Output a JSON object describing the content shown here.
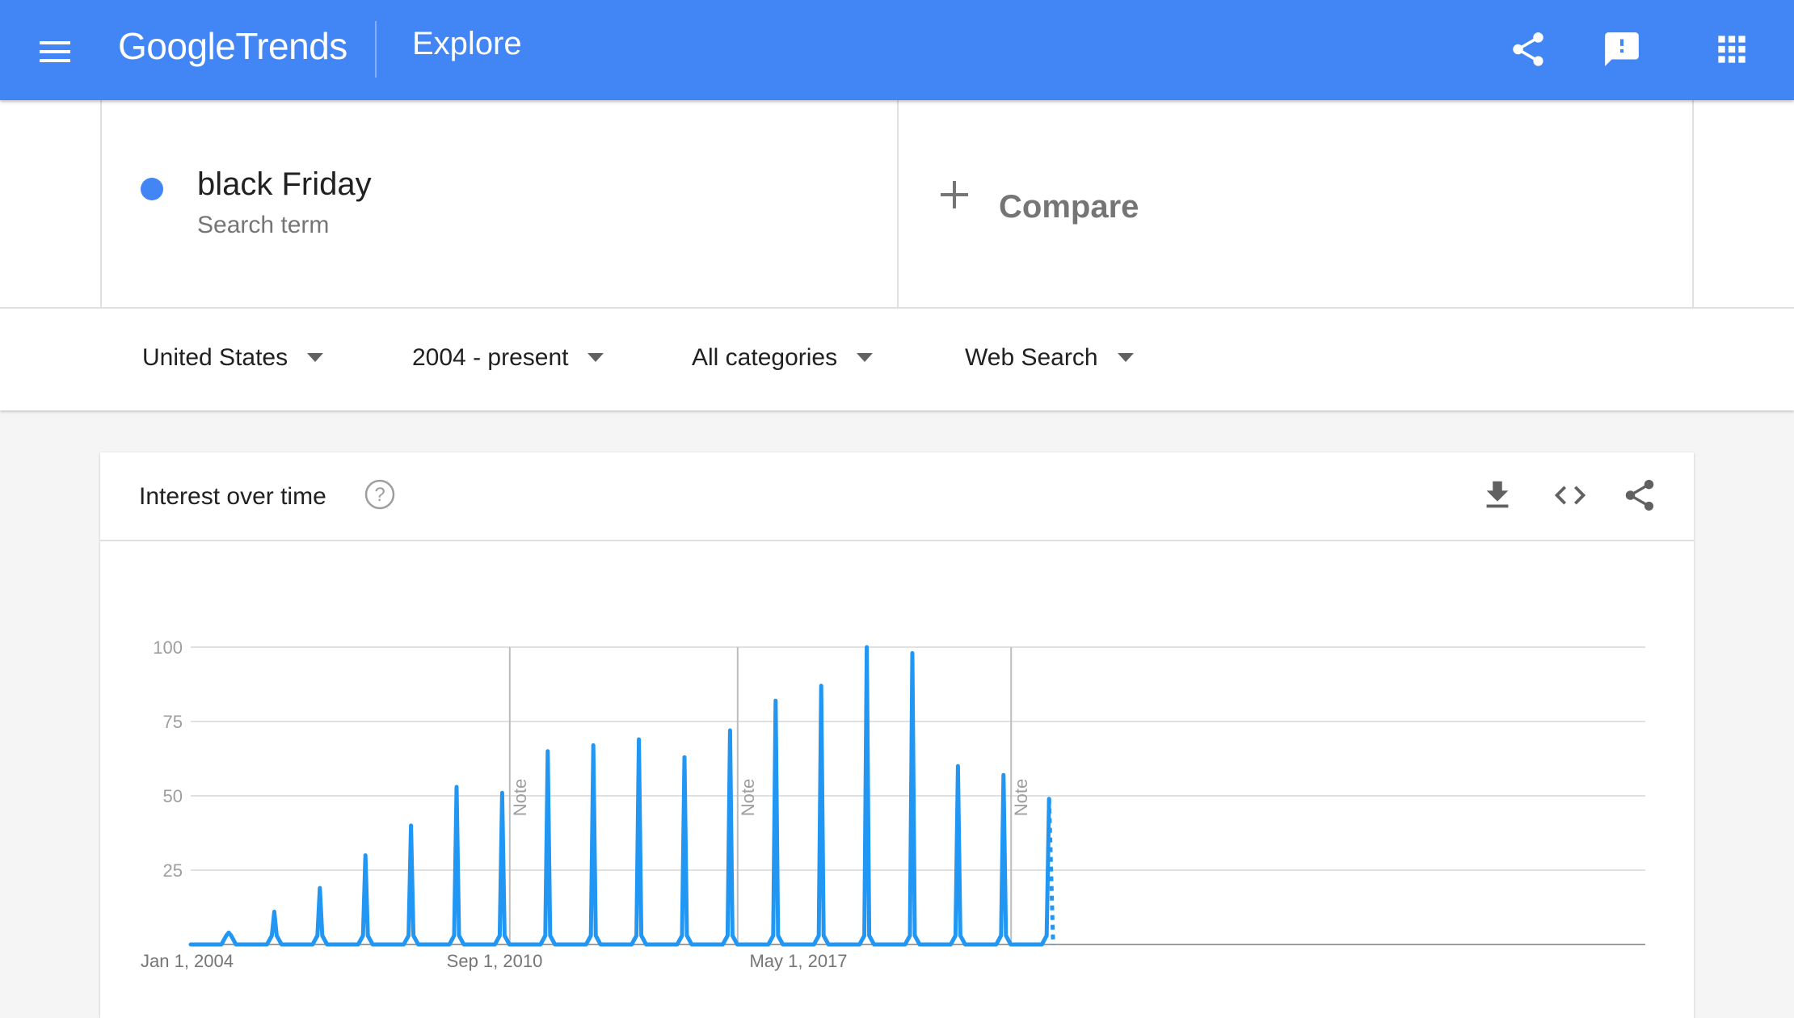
{
  "appbar": {
    "logo_google": "Google",
    "logo_trends": "Trends",
    "page": "Explore",
    "icons": [
      "menu-icon",
      "share-icon",
      "feedback-icon",
      "apps-icon"
    ]
  },
  "terms": {
    "term": {
      "name": "black Friday",
      "type": "Search term",
      "color": "#4285f4"
    },
    "compare_label": "Compare"
  },
  "filters": [
    {
      "label": "United States"
    },
    {
      "label": "2004 - present"
    },
    {
      "label": "All categories"
    },
    {
      "label": "Web Search"
    }
  ],
  "card": {
    "title": "Interest over time",
    "tools": [
      "download-icon",
      "embed-icon",
      "share-icon"
    ]
  },
  "colors": {
    "accent": "#4285f4",
    "series": "#2196f3",
    "grid": "#e0e0e0"
  },
  "chart_data": {
    "type": "line",
    "title": "",
    "xlabel": "",
    "ylabel": "",
    "ylim": [
      0,
      100
    ],
    "yticks": [
      25,
      50,
      75,
      100
    ],
    "x_range": [
      "2004-01",
      "2020-11"
    ],
    "x_ticks": [
      {
        "date": "2004-01",
        "label": "Jan 1, 2004"
      },
      {
        "date": "2010-09",
        "label": "Sep 1, 2010"
      },
      {
        "date": "2017-05",
        "label": "May 1, 2017"
      }
    ],
    "notes": [
      {
        "date": "2011-01",
        "label": "Note"
      },
      {
        "date": "2016-01",
        "label": "Note"
      },
      {
        "date": "2022-01",
        "label": "Note"
      }
    ],
    "grid": true,
    "series": [
      {
        "name": "",
        "baseline": 0,
        "peaks": [
          {
            "date": "2004-11",
            "value": 4
          },
          {
            "date": "2005-11",
            "value": 11
          },
          {
            "date": "2006-11",
            "value": 19
          },
          {
            "date": "2007-11",
            "value": 30
          },
          {
            "date": "2008-11",
            "value": 40
          },
          {
            "date": "2009-11",
            "value": 53
          },
          {
            "date": "2010-11",
            "value": 51
          },
          {
            "date": "2011-11",
            "value": 65
          },
          {
            "date": "2012-11",
            "value": 67
          },
          {
            "date": "2013-11",
            "value": 69
          },
          {
            "date": "2014-11",
            "value": 63
          },
          {
            "date": "2015-11",
            "value": 72
          },
          {
            "date": "2016-11",
            "value": 82
          },
          {
            "date": "2017-11",
            "value": 87
          },
          {
            "date": "2018-11",
            "value": 100
          },
          {
            "date": "2019-11",
            "value": 98
          },
          {
            "date": "2020-11",
            "value": 60
          },
          {
            "date": "2021-11",
            "value": 57
          },
          {
            "date": "2022-11",
            "value": 49
          }
        ],
        "partial_from": "2022-11"
      }
    ]
  }
}
